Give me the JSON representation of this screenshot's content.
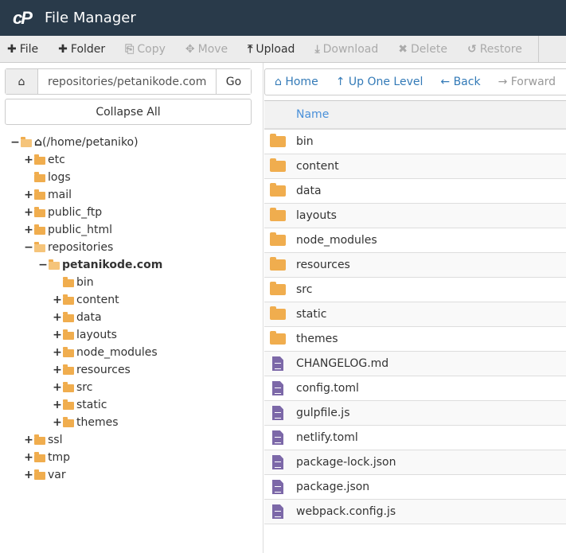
{
  "header": {
    "logo": "cP",
    "title": "File Manager"
  },
  "toolbar": [
    {
      "label": "File",
      "icon": "plus-icon",
      "glyph": "✚",
      "enabled": true
    },
    {
      "label": "Folder",
      "icon": "plus-icon",
      "glyph": "✚",
      "enabled": true
    },
    {
      "label": "Copy",
      "icon": "copy-icon",
      "glyph": "⎘",
      "enabled": false
    },
    {
      "label": "Move",
      "icon": "move-icon",
      "glyph": "✥",
      "enabled": false
    },
    {
      "label": "Upload",
      "icon": "upload-icon",
      "glyph": "⤒",
      "enabled": true
    },
    {
      "label": "Download",
      "icon": "download-icon",
      "glyph": "⤓",
      "enabled": false
    },
    {
      "label": "Delete",
      "icon": "delete-icon",
      "glyph": "✖",
      "enabled": false
    },
    {
      "label": "Restore",
      "icon": "restore-icon",
      "glyph": "↺",
      "enabled": false
    }
  ],
  "pathbar": {
    "value": "repositories/petanikode.com",
    "go": "Go"
  },
  "collapse_all": "Collapse All",
  "tree": [
    {
      "label": "(/home/petaniko)",
      "level": 0,
      "toggle": "−",
      "open": true,
      "home": true
    },
    {
      "label": "etc",
      "level": 1,
      "toggle": "+"
    },
    {
      "label": "logs",
      "level": 1,
      "toggle": ""
    },
    {
      "label": "mail",
      "level": 1,
      "toggle": "+"
    },
    {
      "label": "public_ftp",
      "level": 1,
      "toggle": "+"
    },
    {
      "label": "public_html",
      "level": 1,
      "toggle": "+"
    },
    {
      "label": "repositories",
      "level": 1,
      "toggle": "−",
      "open": true
    },
    {
      "label": "petanikode.com",
      "level": 2,
      "toggle": "−",
      "open": true,
      "bold": true
    },
    {
      "label": "bin",
      "level": 3,
      "toggle": ""
    },
    {
      "label": "content",
      "level": 3,
      "toggle": "+"
    },
    {
      "label": "data",
      "level": 3,
      "toggle": "+"
    },
    {
      "label": "layouts",
      "level": 3,
      "toggle": "+"
    },
    {
      "label": "node_modules",
      "level": 3,
      "toggle": "+"
    },
    {
      "label": "resources",
      "level": 3,
      "toggle": "+"
    },
    {
      "label": "src",
      "level": 3,
      "toggle": "+"
    },
    {
      "label": "static",
      "level": 3,
      "toggle": "+"
    },
    {
      "label": "themes",
      "level": 3,
      "toggle": "+"
    },
    {
      "label": "ssl",
      "level": 1,
      "toggle": "+"
    },
    {
      "label": "tmp",
      "level": 1,
      "toggle": "+"
    },
    {
      "label": "var",
      "level": 1,
      "toggle": "+"
    }
  ],
  "nav": [
    {
      "label": "Home",
      "glyph": "⌂",
      "icon": "home-icon",
      "color": "#337ab7"
    },
    {
      "label": "Up One Level",
      "glyph": "↑",
      "icon": "up-level-icon",
      "color": "#337ab7"
    },
    {
      "label": "Back",
      "glyph": "←",
      "icon": "back-arrow-icon",
      "color": "#337ab7"
    },
    {
      "label": "Forward",
      "glyph": "→",
      "icon": "forward-arrow-icon",
      "color": "#999999"
    }
  ],
  "table": {
    "header": "Name",
    "rows": [
      {
        "name": "bin",
        "type": "folder"
      },
      {
        "name": "content",
        "type": "folder"
      },
      {
        "name": "data",
        "type": "folder"
      },
      {
        "name": "layouts",
        "type": "folder"
      },
      {
        "name": "node_modules",
        "type": "folder"
      },
      {
        "name": "resources",
        "type": "folder"
      },
      {
        "name": "src",
        "type": "folder"
      },
      {
        "name": "static",
        "type": "folder"
      },
      {
        "name": "themes",
        "type": "folder"
      },
      {
        "name": "CHANGELOG.md",
        "type": "file"
      },
      {
        "name": "config.toml",
        "type": "file"
      },
      {
        "name": "gulpfile.js",
        "type": "file"
      },
      {
        "name": "netlify.toml",
        "type": "file"
      },
      {
        "name": "package-lock.json",
        "type": "file"
      },
      {
        "name": "package.json",
        "type": "file"
      },
      {
        "name": "webpack.config.js",
        "type": "file"
      }
    ]
  },
  "colors": {
    "header_bg": "#293a4a",
    "folder": "#f0ad4e",
    "file": "#7c68a8",
    "link": "#337ab7"
  }
}
